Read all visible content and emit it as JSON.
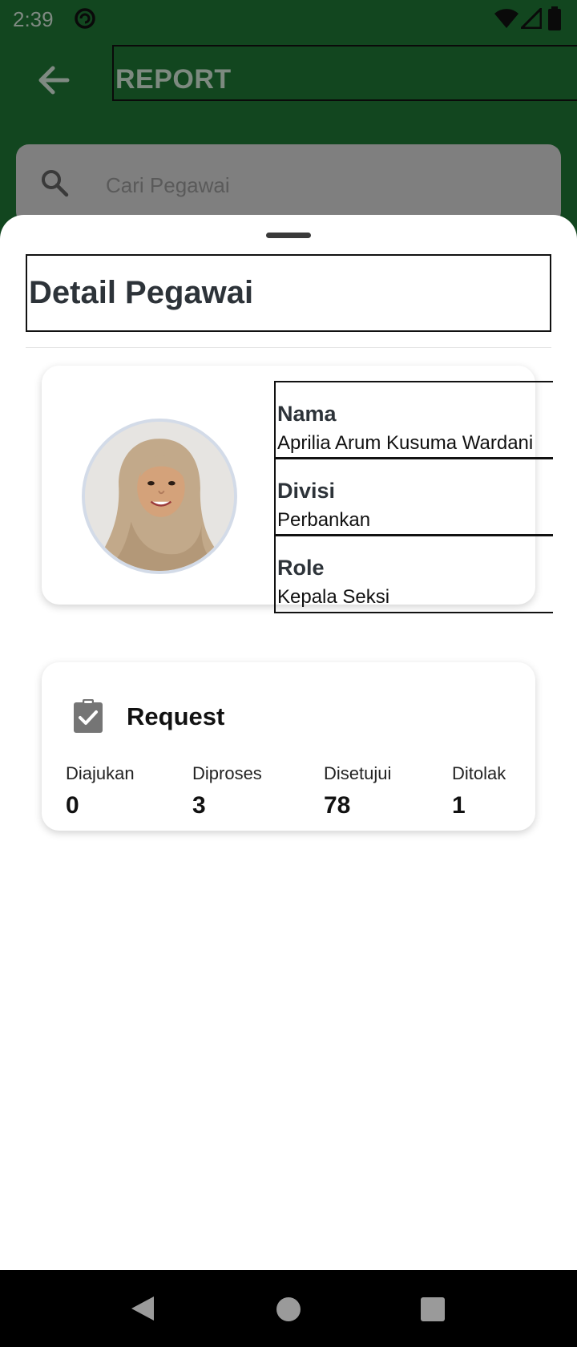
{
  "status_bar": {
    "time": "2:39"
  },
  "app_bar": {
    "title": "REPORT"
  },
  "search": {
    "placeholder": "Cari Pegawai"
  },
  "sheet": {
    "title": "Detail Pegawai",
    "employee": {
      "fields": [
        {
          "label": "Nama",
          "value": "Aprilia Arum Kusuma Wardani"
        },
        {
          "label": "Divisi",
          "value": "Perbankan"
        },
        {
          "label": "Role",
          "value": "Kepala Seksi"
        }
      ]
    },
    "request": {
      "title": "Request",
      "stats": [
        {
          "label": "Diajukan",
          "value": "0"
        },
        {
          "label": "Diproses",
          "value": "3"
        },
        {
          "label": "Disetujui",
          "value": "78"
        },
        {
          "label": "Ditolak",
          "value": "1"
        }
      ]
    }
  },
  "icons": {
    "back": "arrow-left-icon",
    "search": "search-icon",
    "request": "clipboard-check-icon"
  },
  "colors": {
    "app_bar_dimmed": "#12461f",
    "search_dimmed": "#7f7f7f",
    "request_icon": "#757575"
  }
}
